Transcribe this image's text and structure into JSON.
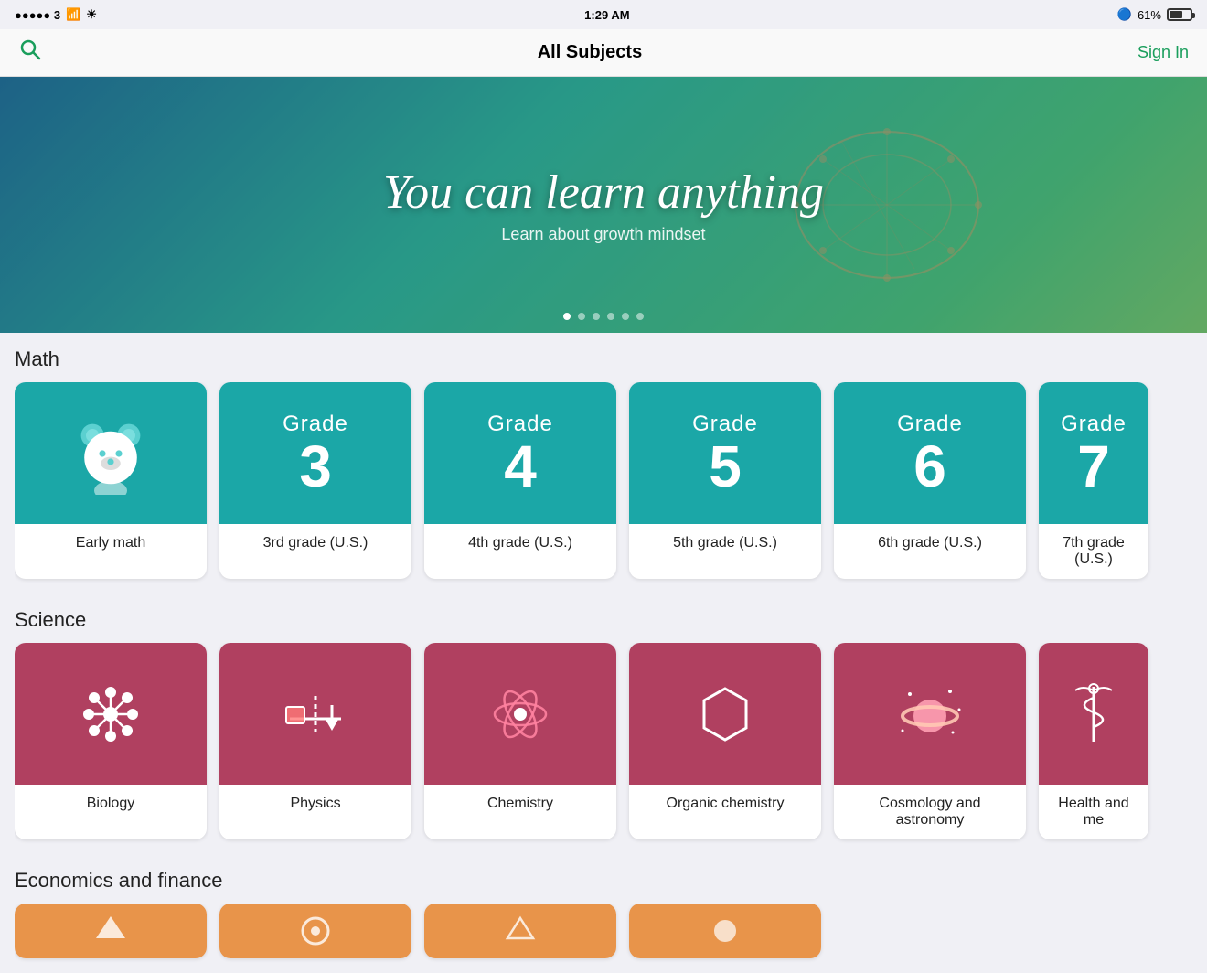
{
  "statusBar": {
    "carrier": "●●●●● 3",
    "wifi": "WiFi",
    "time": "1:29 AM",
    "bluetooth": "BT",
    "battery": "61%"
  },
  "nav": {
    "title": "All Subjects",
    "signin": "Sign In"
  },
  "hero": {
    "title": "You can learn anything",
    "subtitle": "Learn about growth mindset",
    "dots": [
      true,
      false,
      false,
      false,
      false,
      false
    ]
  },
  "math": {
    "sectionTitle": "Math",
    "cards": [
      {
        "type": "icon",
        "label": "Early math",
        "color": "teal"
      },
      {
        "type": "grade",
        "grade": "3",
        "label": "3rd grade (U.S.)",
        "color": "teal"
      },
      {
        "type": "grade",
        "grade": "4",
        "label": "4th grade (U.S.)",
        "color": "teal"
      },
      {
        "type": "grade",
        "grade": "5",
        "label": "5th grade (U.S.)",
        "color": "teal"
      },
      {
        "type": "grade",
        "grade": "6",
        "label": "6th grade (U.S.)",
        "color": "teal"
      },
      {
        "type": "grade",
        "grade": "7",
        "label": "7th grade (U.S.)",
        "color": "teal",
        "partial": true
      }
    ]
  },
  "science": {
    "sectionTitle": "Science",
    "cards": [
      {
        "type": "science",
        "subject": "biology",
        "label": "Biology",
        "color": "red"
      },
      {
        "type": "science",
        "subject": "physics",
        "label": "Physics",
        "color": "red"
      },
      {
        "type": "science",
        "subject": "chemistry",
        "label": "Chemistry",
        "color": "red"
      },
      {
        "type": "science",
        "subject": "organic",
        "label": "Organic chemistry",
        "color": "red"
      },
      {
        "type": "science",
        "subject": "cosmology",
        "label": "Cosmology and astronomy",
        "color": "red"
      },
      {
        "type": "science",
        "subject": "health",
        "label": "Health and me",
        "color": "red",
        "partial": true
      }
    ]
  },
  "economics": {
    "sectionTitle": "Economics and finance",
    "cards": [
      {
        "color": "orange",
        "partial": false
      },
      {
        "color": "orange",
        "partial": false
      },
      {
        "color": "orange",
        "partial": false
      },
      {
        "color": "orange",
        "partial": false
      }
    ]
  }
}
